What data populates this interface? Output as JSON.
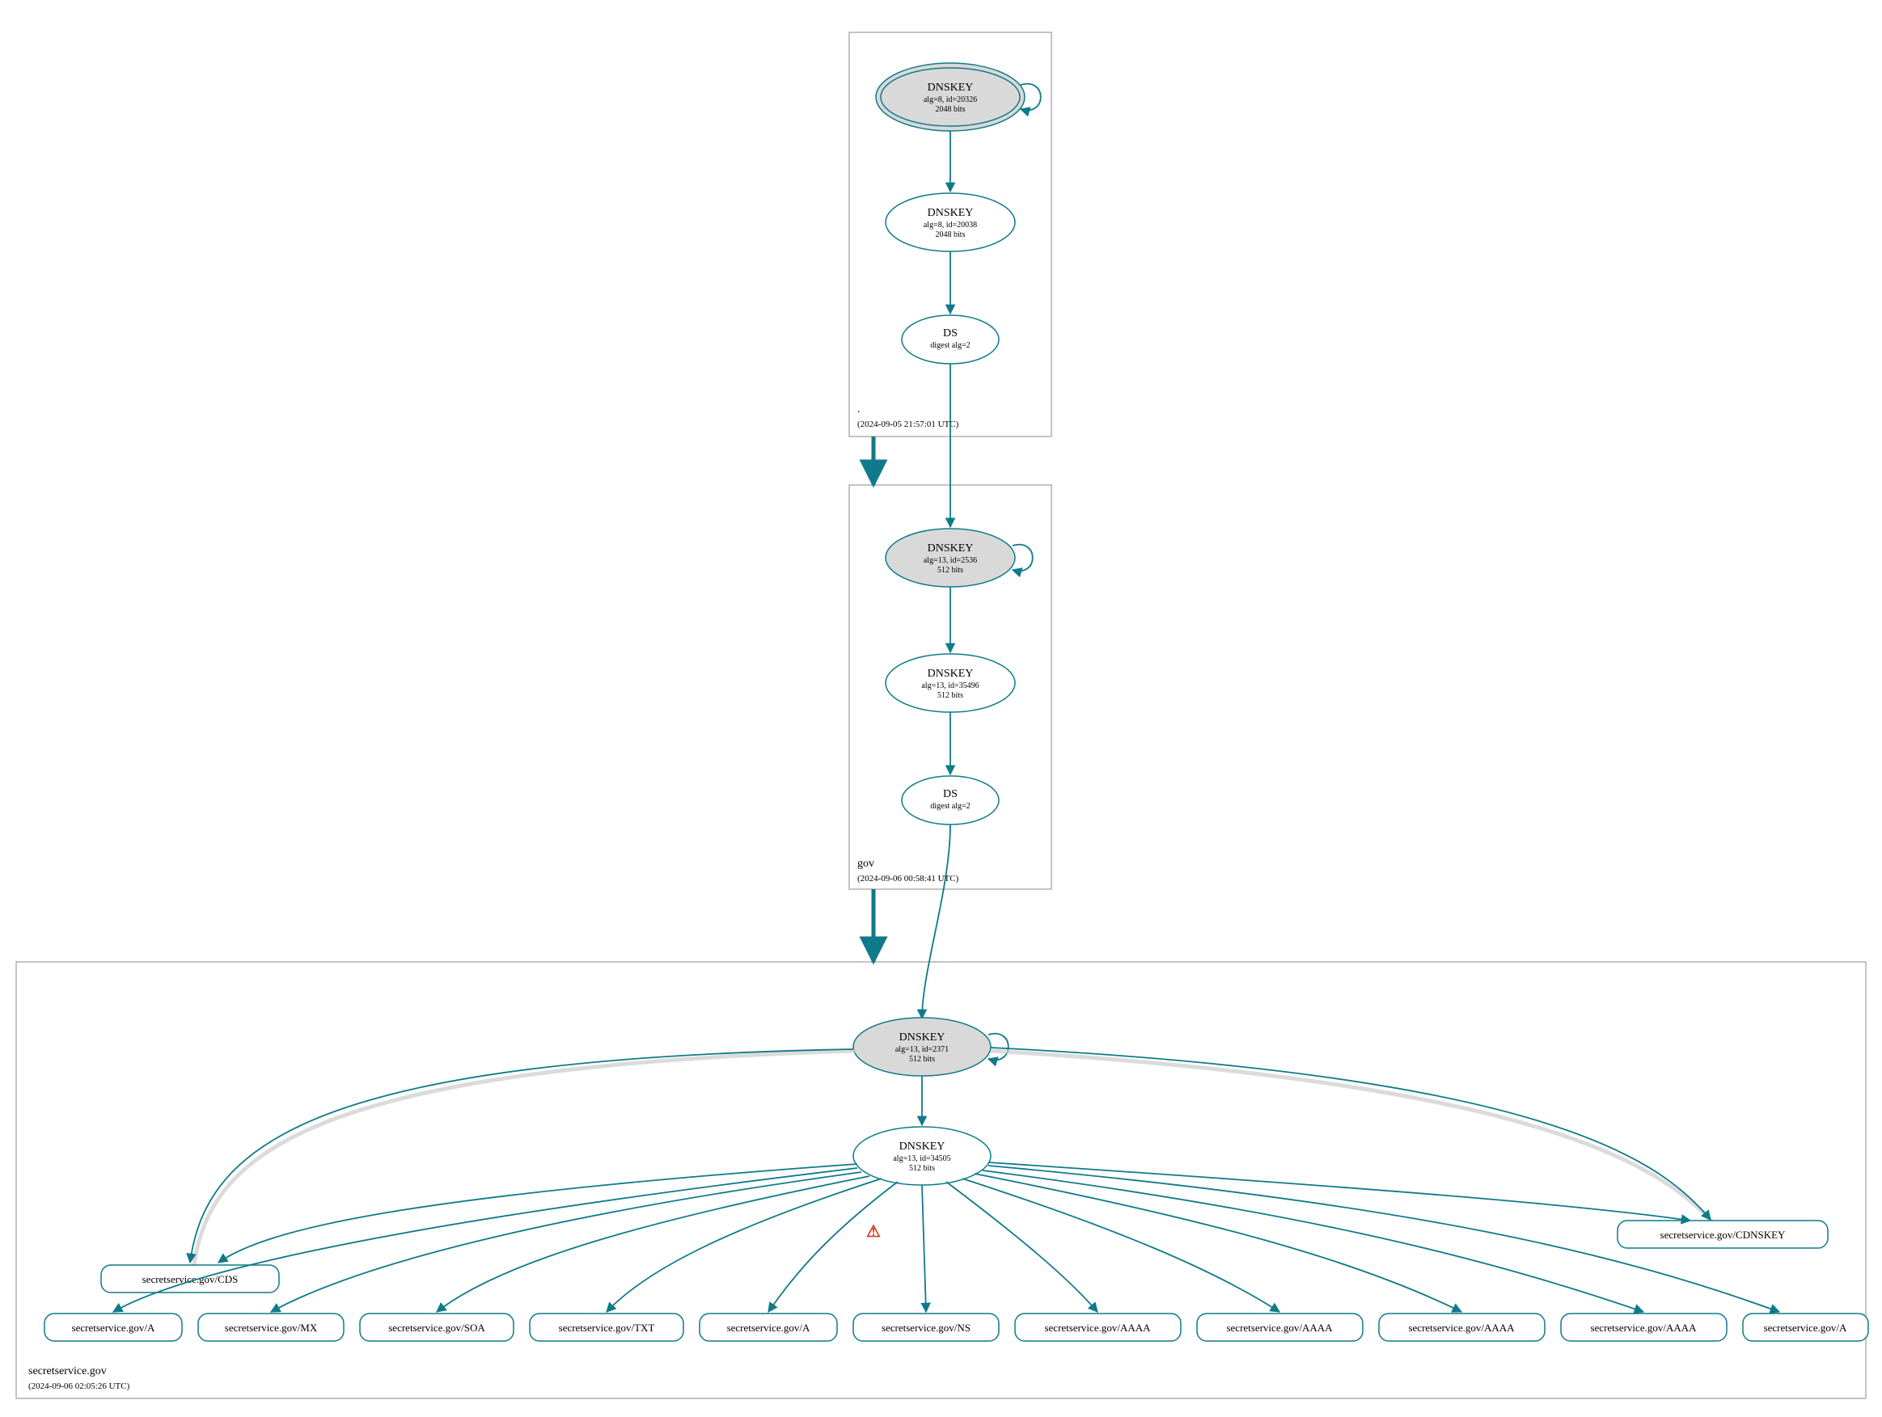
{
  "zones": {
    "root": {
      "name": ".",
      "timestamp": "(2024-09-05 21:57:01 UTC)"
    },
    "tld": {
      "name": "gov",
      "timestamp": "(2024-09-06 00:58:41 UTC)"
    },
    "domain": {
      "name": "secretservice.gov",
      "timestamp": "(2024-09-06 02:05:26 UTC)"
    }
  },
  "nodes": {
    "root_ksk": {
      "title": "DNSKEY",
      "l1": "alg=8, id=20326",
      "l2": "2048 bits"
    },
    "root_zsk": {
      "title": "DNSKEY",
      "l1": "alg=8, id=20038",
      "l2": "2048 bits"
    },
    "root_ds": {
      "title": "DS",
      "l1": "digest alg=2",
      "l2": ""
    },
    "tld_ksk": {
      "title": "DNSKEY",
      "l1": "alg=13, id=2536",
      "l2": "512 bits"
    },
    "tld_zsk": {
      "title": "DNSKEY",
      "l1": "alg=13, id=35496",
      "l2": "512 bits"
    },
    "tld_ds": {
      "title": "DS",
      "l1": "digest alg=2",
      "l2": ""
    },
    "dom_ksk": {
      "title": "DNSKEY",
      "l1": "alg=13, id=2371",
      "l2": "512 bits"
    },
    "dom_zsk": {
      "title": "DNSKEY",
      "l1": "alg=13, id=34505",
      "l2": "512 bits"
    }
  },
  "rr": {
    "cds": "secretservice.gov/CDS",
    "cdnskey": "secretservice.gov/CDNSKEY",
    "a1": "secretservice.gov/A",
    "mx": "secretservice.gov/MX",
    "soa": "secretservice.gov/SOA",
    "txt": "secretservice.gov/TXT",
    "a2": "secretservice.gov/A",
    "ns": "secretservice.gov/NS",
    "aaaa1": "secretservice.gov/AAAA",
    "aaaa2": "secretservice.gov/AAAA",
    "aaaa3": "secretservice.gov/AAAA",
    "aaaa4": "secretservice.gov/AAAA",
    "a3": "secretservice.gov/A"
  },
  "warning_glyph": "⚠",
  "colors": {
    "stroke": "#0f7a8a",
    "ksk_fill": "#d9d9d9",
    "zone_border": "#888888",
    "warn": "#d04020"
  }
}
